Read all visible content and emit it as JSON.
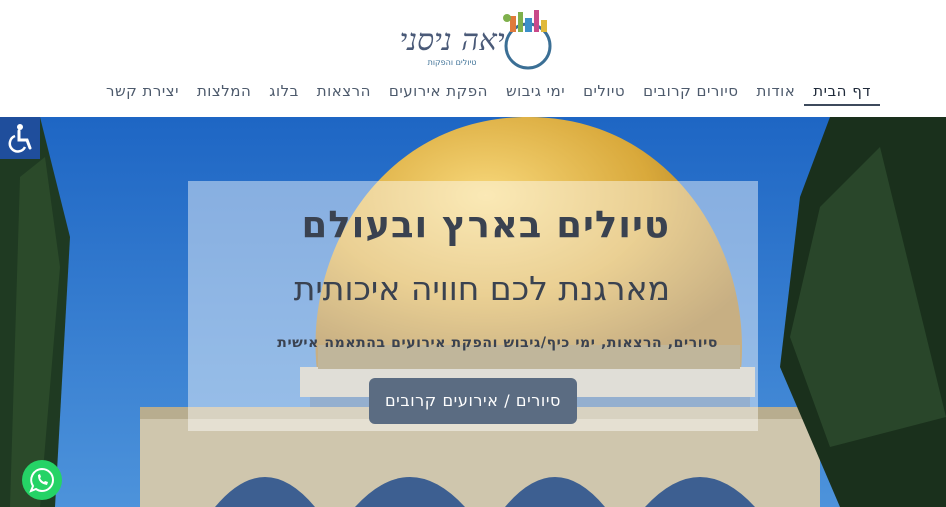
{
  "logo": {
    "title": "יאה ניסני",
    "subtitle": "טיולים והפקות"
  },
  "nav": {
    "items": [
      {
        "label": "דף הבית",
        "active": true
      },
      {
        "label": "אודות",
        "active": false
      },
      {
        "label": "סיורים קרובים",
        "active": false
      },
      {
        "label": "טיולים",
        "active": false
      },
      {
        "label": "ימי גיבוש",
        "active": false
      },
      {
        "label": "הפקת אירועים",
        "active": false
      },
      {
        "label": "הרצאות",
        "active": false
      },
      {
        "label": "בלוג",
        "active": false
      },
      {
        "label": "המלצות",
        "active": false
      },
      {
        "label": "יצירת קשר",
        "active": false
      }
    ]
  },
  "hero": {
    "title": "טיולים בארץ ובעולם",
    "subtitle": "מארגנת לכם חוויה איכותית",
    "description": "סיורים, הרצאות, ימי כיף/גיבוש והפקת אירועים בהתאמה אישית",
    "cta_label": "סיורים / אירועים קרובים",
    "background": "dome-of-the-rock-photo"
  },
  "widgets": {
    "accessibility_icon": "wheelchair-icon",
    "whatsapp_icon": "whatsapp-icon"
  },
  "colors": {
    "nav_text": "#4d5a6c",
    "cta_bg": "#5b6c82",
    "accessibility_bg": "#1f4e9c",
    "whatsapp_bg": "#25d366",
    "sky": "#2a73c9",
    "dome_gold": "#d9a93b"
  }
}
